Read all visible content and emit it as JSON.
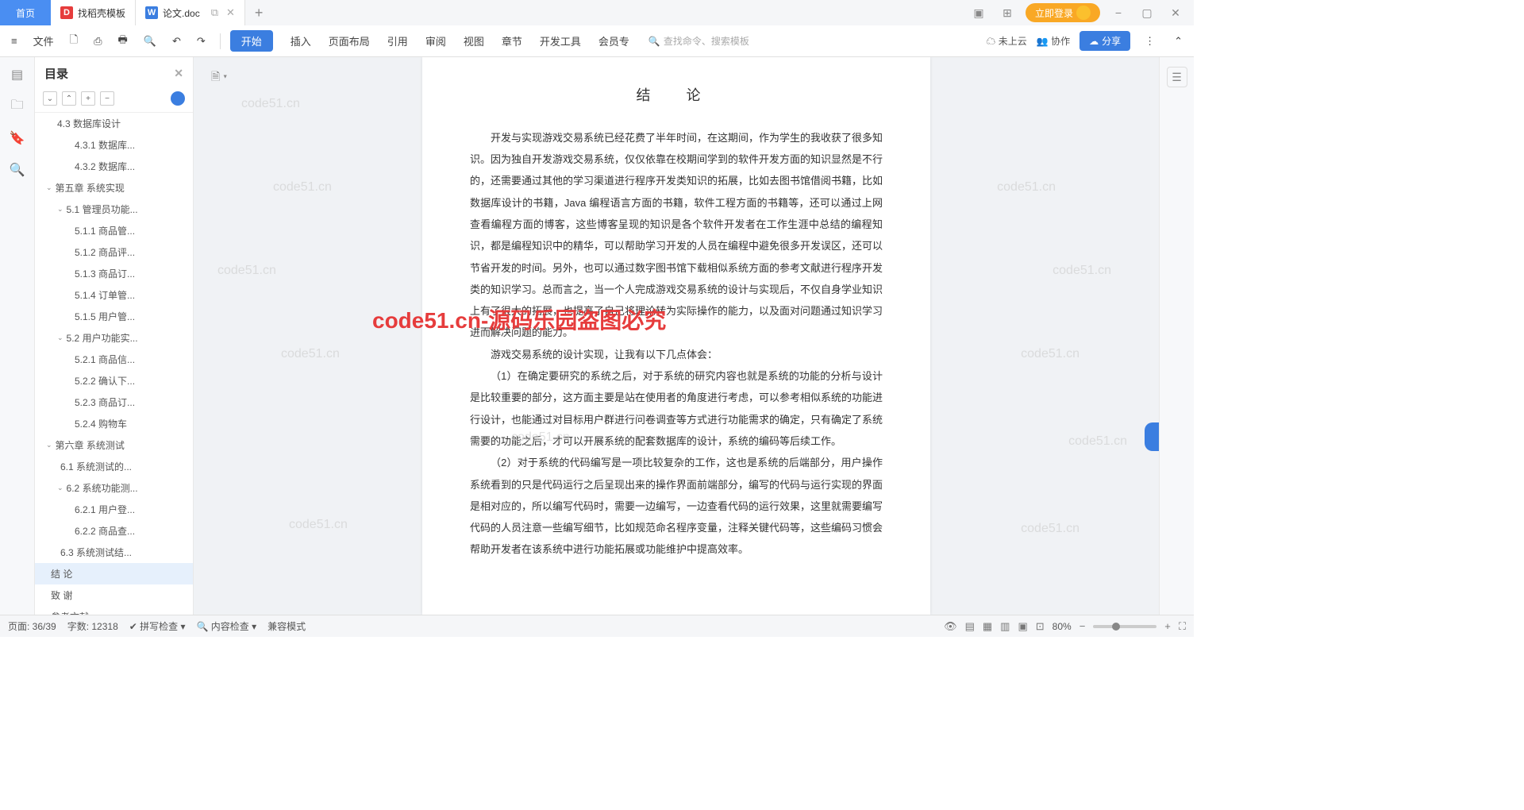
{
  "titlebar": {
    "home": "首页",
    "tab1": "找稻壳模板",
    "tab2": "论文.doc",
    "login": "立即登录"
  },
  "toolbar": {
    "file": "文件",
    "start": "开始",
    "menus": [
      "插入",
      "页面布局",
      "引用",
      "审阅",
      "视图",
      "章节",
      "开发工具",
      "会员专"
    ],
    "search_ph": "查找命令、搜索模板",
    "cloud": "未上云",
    "collab": "协作",
    "share": "分享"
  },
  "outline": {
    "title": "目录",
    "items": [
      {
        "pad": 28,
        "arrow": "",
        "text": "4.3 数据库设计"
      },
      {
        "pad": 50,
        "arrow": "",
        "text": "4.3.1 数据库..."
      },
      {
        "pad": 50,
        "arrow": "",
        "text": "4.3.2 数据库..."
      },
      {
        "pad": 14,
        "arrow": "⌄",
        "text": "第五章  系统实现"
      },
      {
        "pad": 28,
        "arrow": "⌄",
        "text": "5.1 管理员功能..."
      },
      {
        "pad": 50,
        "arrow": "",
        "text": "5.1.1 商品管..."
      },
      {
        "pad": 50,
        "arrow": "",
        "text": "5.1.2 商品评..."
      },
      {
        "pad": 50,
        "arrow": "",
        "text": "5.1.3 商品订..."
      },
      {
        "pad": 50,
        "arrow": "",
        "text": "5.1.4 订单管..."
      },
      {
        "pad": 50,
        "arrow": "",
        "text": "5.1.5 用户管..."
      },
      {
        "pad": 28,
        "arrow": "⌄",
        "text": "5.2 用户功能实..."
      },
      {
        "pad": 50,
        "arrow": "",
        "text": "5.2.1 商品信..."
      },
      {
        "pad": 50,
        "arrow": "",
        "text": "5.2.2 确认下..."
      },
      {
        "pad": 50,
        "arrow": "",
        "text": "5.2.3 商品订..."
      },
      {
        "pad": 50,
        "arrow": "",
        "text": "5.2.4 购物车"
      },
      {
        "pad": 14,
        "arrow": "⌄",
        "text": "第六章  系统测试"
      },
      {
        "pad": 32,
        "arrow": "",
        "text": "6.1 系统测试的..."
      },
      {
        "pad": 28,
        "arrow": "⌄",
        "text": "6.2  系统功能测..."
      },
      {
        "pad": 50,
        "arrow": "",
        "text": "6.2.1 用户登..."
      },
      {
        "pad": 50,
        "arrow": "",
        "text": "6.2.2 商品查..."
      },
      {
        "pad": 32,
        "arrow": "",
        "text": "6.3 系统测试结..."
      },
      {
        "pad": 20,
        "arrow": "",
        "text": "结  论",
        "active": true
      },
      {
        "pad": 20,
        "arrow": "",
        "text": "致  谢"
      },
      {
        "pad": 20,
        "arrow": "",
        "text": "参考文献"
      }
    ]
  },
  "doc": {
    "title": "结  论",
    "p1": "开发与实现游戏交易系统已经花费了半年时间，在这期间，作为学生的我收获了很多知识。因为独自开发游戏交易系统，仅仅依靠在校期间学到的软件开发方面的知识显然是不行的，还需要通过其他的学习渠道进行程序开发类知识的拓展，比如去图书馆借阅书籍，比如数据库设计的书籍，Java 编程语言方面的书籍，软件工程方面的书籍等，还可以通过上网查看编程方面的博客，这些博客呈现的知识是各个软件开发者在工作生涯中总结的编程知识，都是编程知识中的精华，可以帮助学习开发的人员在编程中避免很多开发误区，还可以节省开发的时间。另外，也可以通过数字图书馆下载相似系统方面的参考文献进行程序开发类的知识学习。总而言之，当一个人完成游戏交易系统的设计与实现后，不仅自身学业知识上有了很大的拓展，也提高了自己将理论转为实际操作的能力，以及面对问题通过知识学习进而解决问题的能力。",
    "p2": "游戏交易系统的设计实现，让我有以下几点体会：",
    "p3": "（1）在确定要研究的系统之后，对于系统的研究内容也就是系统的功能的分析与设计是比较重要的部分，这方面主要是站在使用者的角度进行考虑，可以参考相似系统的功能进行设计，也能通过对目标用户群进行问卷调查等方式进行功能需求的确定，只有确定了系统需要的功能之后，才可以开展系统的配套数据库的设计，系统的编码等后续工作。",
    "p4": "（2）对于系统的代码编写是一项比较复杂的工作，这也是系统的后端部分，用户操作系统看到的只是代码运行之后呈现出来的操作界面前端部分，编写的代码与运行实现的界面是相对应的，所以编写代码时，需要一边编写，一边查看代码的运行效果，这里就需要编写代码的人员注意一些编写细节，比如规范命名程序变量，注释关键代码等，这些编码习惯会帮助开发者在该系统中进行功能拓展或功能维护中提高效率。"
  },
  "watermarks": {
    "wm": "code51.cn",
    "red": "code51.cn-源码乐园盗图必究"
  },
  "statusbar": {
    "page": "页面: 36/39",
    "words": "字数: 12318",
    "spell": "拼写检查",
    "content": "内容检查",
    "compat": "兼容模式",
    "zoom": "80%"
  }
}
